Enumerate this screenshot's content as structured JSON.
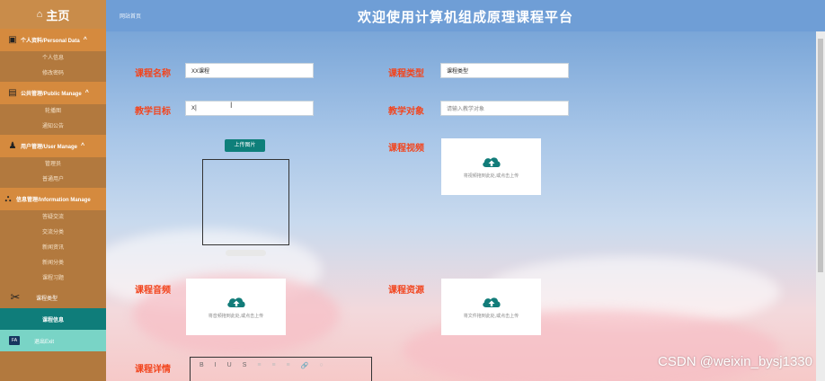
{
  "sidebar": {
    "home_icon": "home-icon",
    "home_label": "主页",
    "groups": [
      {
        "icon": "person-card-icon",
        "label": "个人资料/Personal Data",
        "subitems": [
          "个人信息",
          "修改密码"
        ]
      },
      {
        "icon": "display-board-icon",
        "label": "公共管理/Public Manage",
        "subitems": [
          "轮播图",
          "通知公告"
        ]
      },
      {
        "icon": "user-gear-icon",
        "label": "用户管理/User Manage",
        "subitems": [
          "管理员",
          "普通用户"
        ]
      },
      {
        "icon": "sitemap-icon",
        "label": "信息管理/Information Manage",
        "subitems": [
          "答疑交流",
          "交流分类",
          "新闻资讯",
          "新闻分类",
          "课程习题"
        ]
      }
    ],
    "course_type_label": "课程类型",
    "course_info_label": "课程信息",
    "exit_label": "退出Exit"
  },
  "header": {
    "breadcrumb": "网站首页",
    "title": "欢迎使用计算机组成原理课程平台"
  },
  "form": {
    "course_name_label": "课程名称",
    "course_name_value": "XX课程",
    "course_type_label": "课程类型",
    "course_type_value": "课程类型",
    "teaching_goal_label": "教学目标",
    "teaching_goal_value": "X",
    "teaching_target_label": "教学对象",
    "teaching_target_placeholder": "请输入教学对象",
    "upload_image_label": "上传图片",
    "course_video_label": "课程视频",
    "video_drop_text": "将视频拖到此处,或点击上传",
    "course_audio_label": "课程音频",
    "audio_drop_text": "将音频拖到此处,或点击上传",
    "course_resource_label": "课程资源",
    "resource_drop_text": "将文件拖到此处,或点击上传",
    "course_detail_label": "课程详情",
    "editor_tools": [
      "B",
      "I",
      "U",
      "S",
      "≡",
      "≡",
      "≡",
      "🔗",
      "○"
    ]
  },
  "watermark": "CSDN @weixin_bysj1330",
  "colors": {
    "sidebar_bg": "#b2793e",
    "group_bg": "#d58a3e",
    "active_bg": "#0f7d7a",
    "exit_bg": "#79d4c6",
    "header_bg": "#6f9ed6",
    "label_red": "#f2451e"
  }
}
